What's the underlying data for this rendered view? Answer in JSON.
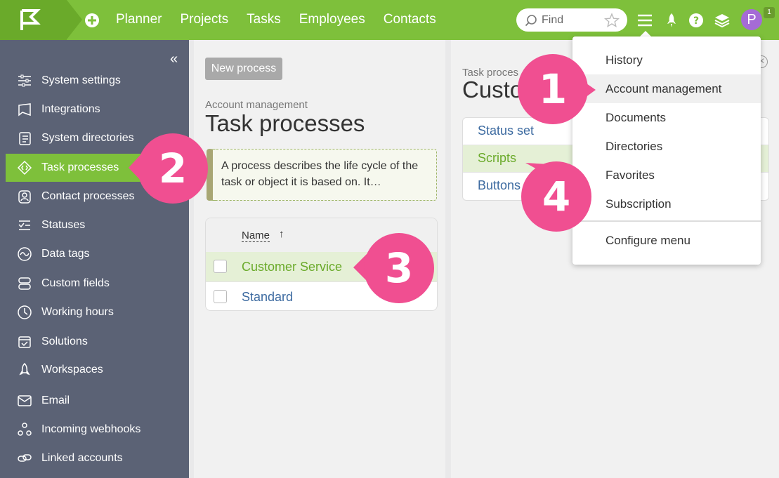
{
  "topbar": {
    "nav": [
      "Planner",
      "Projects",
      "Tasks",
      "Employees",
      "Contacts"
    ],
    "search_placeholder": "Find",
    "avatar_letter": "P",
    "notif_count": "1",
    "colors": {
      "bar": "#7ec03b",
      "logo_block": "#6aaa2a",
      "avatar": "#a56bd6"
    }
  },
  "sidebar": {
    "collapse": "«",
    "items": [
      {
        "label": "System settings",
        "icon": "sliders-icon"
      },
      {
        "label": "Integrations",
        "icon": "puzzle-icon"
      },
      {
        "label": "System directories",
        "icon": "book-icon"
      },
      {
        "label": "Task processes",
        "icon": "diamond-code-icon"
      },
      {
        "label": "Contact processes",
        "icon": "contact-book-icon"
      },
      {
        "label": "Statuses",
        "icon": "checklist-icon"
      },
      {
        "label": "Data tags",
        "icon": "wave-icon"
      },
      {
        "label": "Custom fields",
        "icon": "fields-icon"
      },
      {
        "label": "Working hours",
        "icon": "clock-icon"
      },
      {
        "label": "Solutions",
        "icon": "calendar-check-icon"
      },
      {
        "label": "Workspaces",
        "icon": "rocket-icon"
      },
      {
        "label": "Email",
        "icon": "mail-icon"
      },
      {
        "label": "Incoming webhooks",
        "icon": "webhook-icon"
      },
      {
        "label": "Linked accounts",
        "icon": "link-icon"
      }
    ]
  },
  "middle": {
    "new_button": "New process",
    "breadcrumb": "Account management",
    "title": "Task processes",
    "hint": "A process describes the life cycle of the task or object it is based on. It…",
    "table": {
      "header": "Name",
      "sort_arrow": "↑",
      "rows": [
        "Customer Service",
        "Standard"
      ]
    }
  },
  "right": {
    "breadcrumb": "Task proces",
    "title": "Custo",
    "close": "✕",
    "items": [
      "Status set",
      "Scripts",
      "Buttons"
    ]
  },
  "dropdown": {
    "items": [
      "History",
      "Account management",
      "Documents",
      "Directories",
      "Favorites",
      "Subscription"
    ],
    "configure": "Configure menu"
  },
  "callouts": [
    "1",
    "2",
    "3",
    "4"
  ]
}
